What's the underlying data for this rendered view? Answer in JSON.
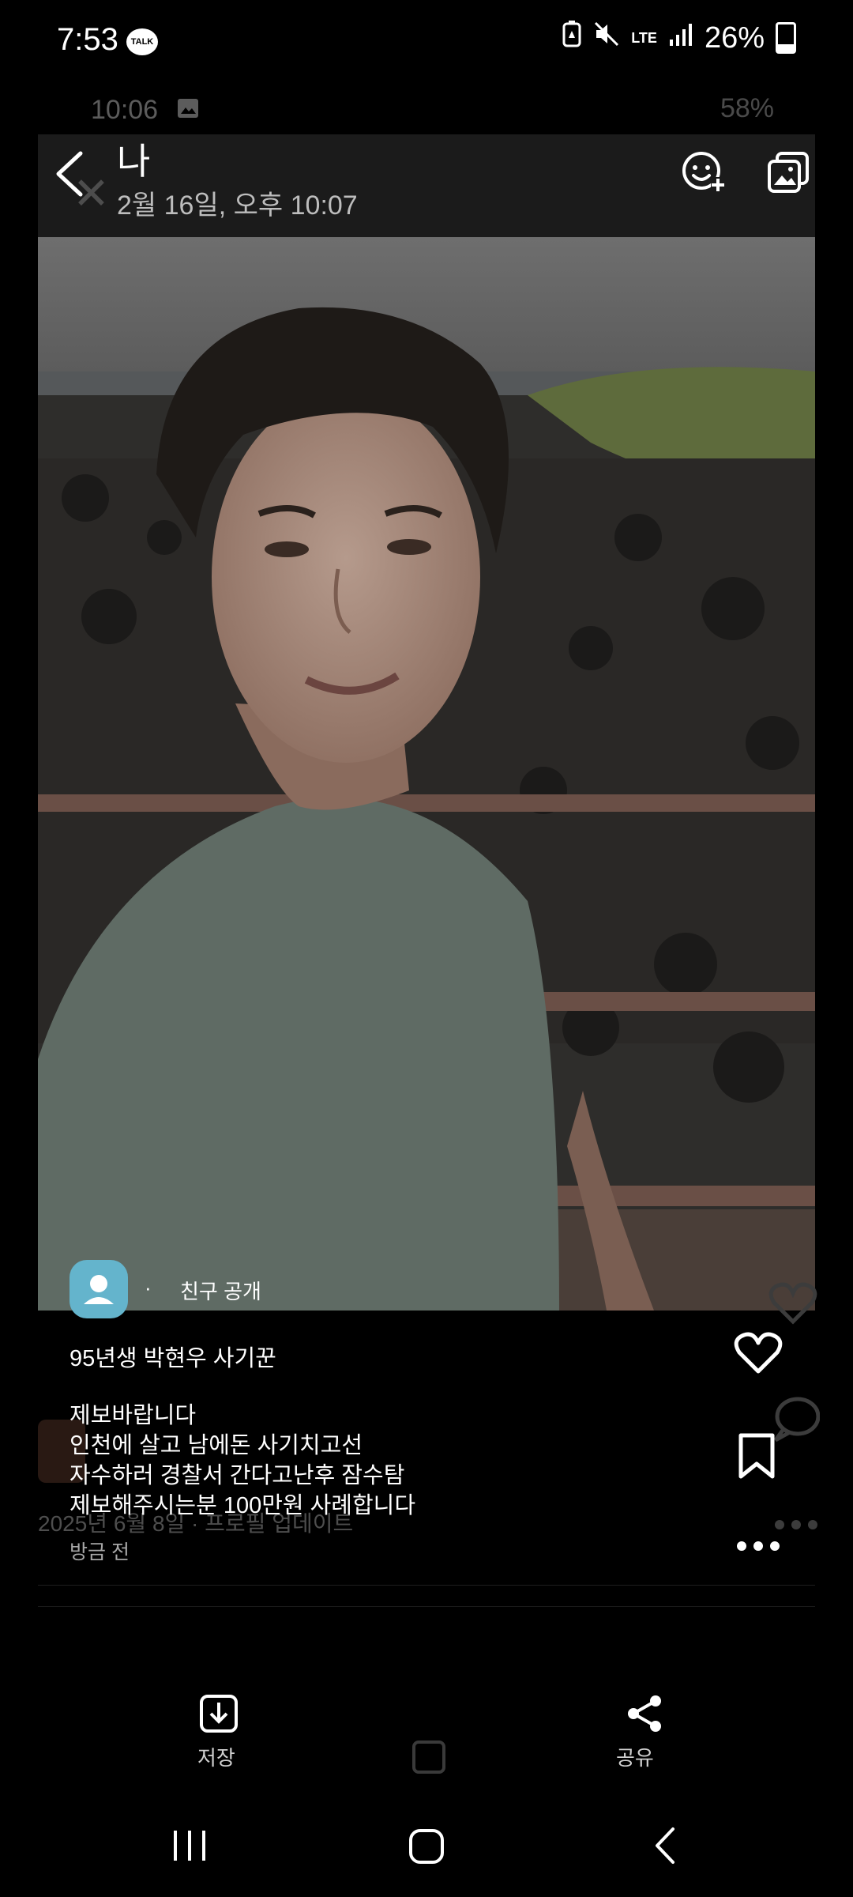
{
  "status_bar": {
    "time": "7:53",
    "talk_badge": "TALK",
    "network": "LTE",
    "battery": "26%",
    "battery_level": 0.26
  },
  "ghost_status_bar": {
    "time": "10:06",
    "battery": "58%"
  },
  "header": {
    "title": "나",
    "date": "2월 16일, 오후 10:07"
  },
  "post": {
    "dot": "·",
    "privacy": "친구 공개",
    "title": "95년생 박현우 사기꾼",
    "body": "제보바랍니다\n인천에 살고 남에돈 사기치고선\n자수하러 경찰서 간다고난후 잠수탐\n제보해주시는분 100만원 사례합니다",
    "time": "방금 전",
    "ghost_update": "2025년 6월 8일 · 프로필 업데이트"
  },
  "actions": {
    "save_label": "저장",
    "share_label": "공유"
  },
  "colors": {
    "background": "#000000",
    "header_bg": "#1b1b1b",
    "avatar": "#64b4cc"
  },
  "icons": [
    "back-icon",
    "close-icon",
    "emoji-add-icon",
    "gallery-icon",
    "heart-icon",
    "bookmark-icon",
    "more-icon",
    "download-icon",
    "share-icon",
    "recent-apps-icon",
    "home-icon",
    "nav-back-icon"
  ]
}
